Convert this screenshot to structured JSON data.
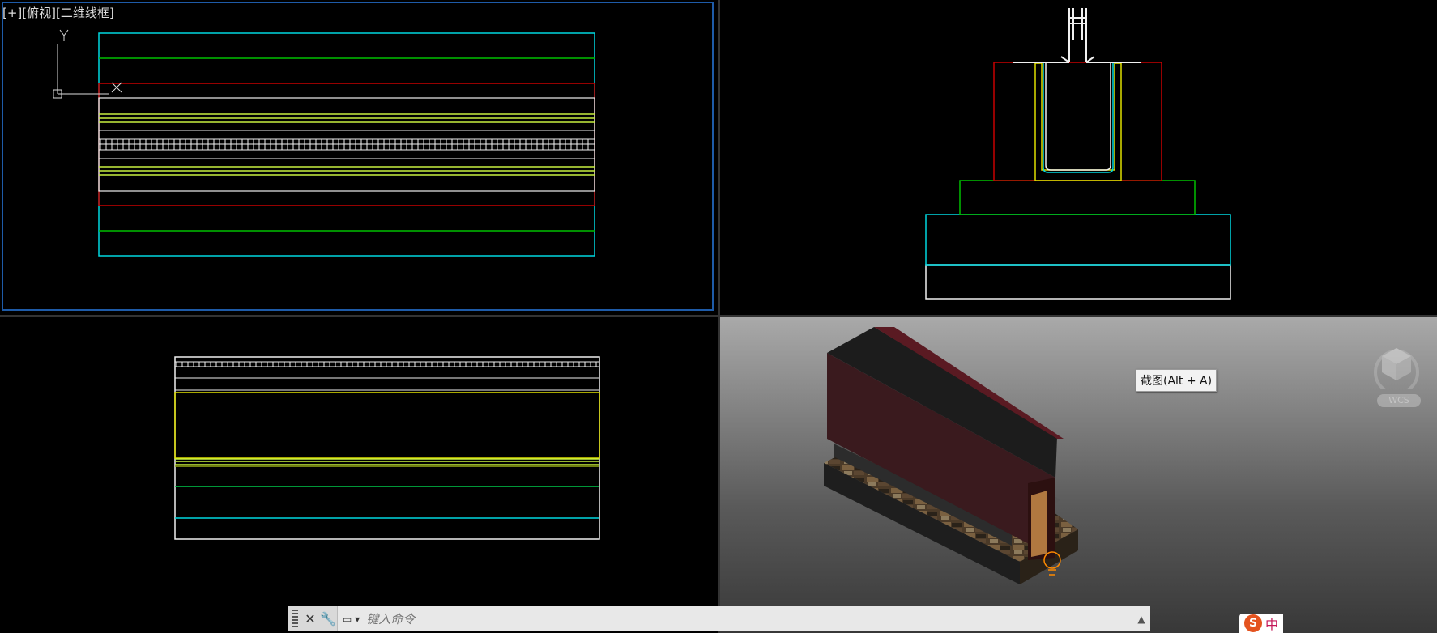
{
  "top_left_viewport": {
    "label_bracket": "[+]",
    "label_view": "[俯视]",
    "label_style": "[二维线框]",
    "ucs_y": "Y",
    "ucs_x": "X"
  },
  "tooltip": {
    "text": "截图(Alt + A)"
  },
  "viewcube": {
    "wcs_label": "WCS"
  },
  "command_line": {
    "placeholder": "键入命令"
  },
  "ime": {
    "logo": "S",
    "mode": "中"
  },
  "colors": {
    "viewport_bg": "#000000",
    "active_border": "#1e5ba8",
    "cyan": "#00d8e0",
    "green": "#00c000",
    "red": "#c80000",
    "yellow": "#e0e000",
    "white": "#f0f0f0"
  }
}
